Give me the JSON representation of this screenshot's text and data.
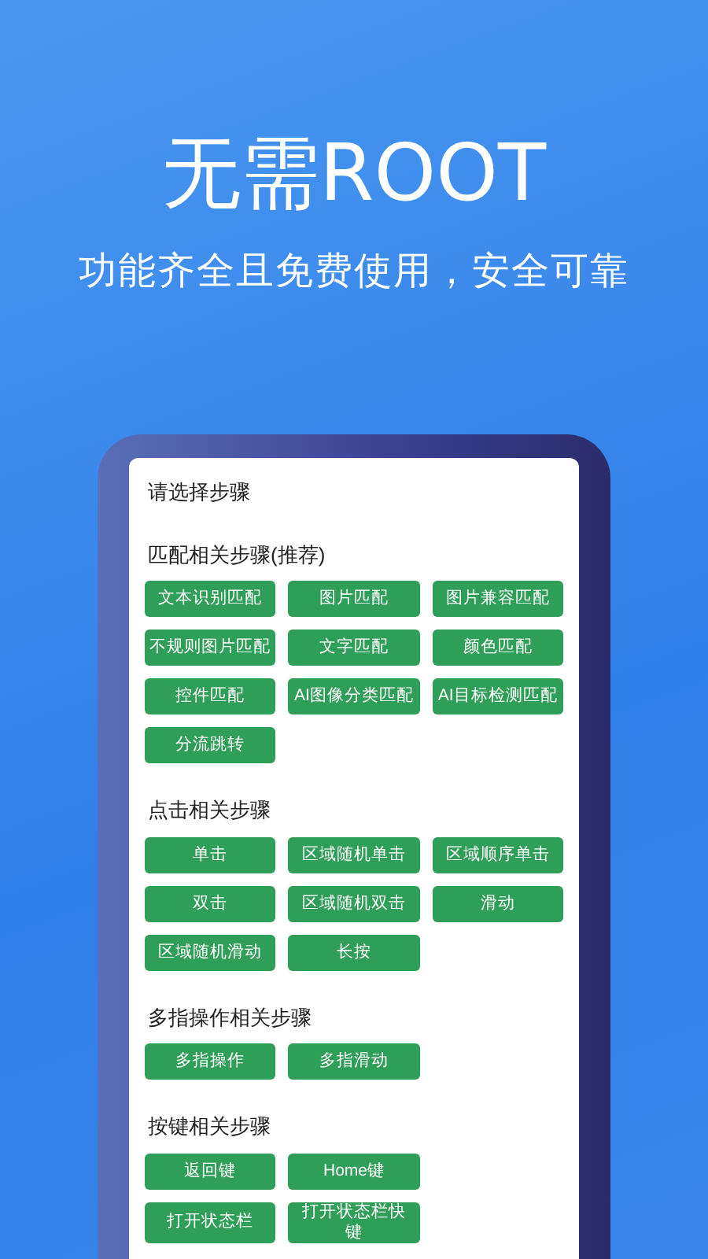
{
  "headline": "无需ROOT",
  "subtitle": "功能齐全且免费使用，安全可靠",
  "screen": {
    "title": "请选择步骤",
    "sections": [
      {
        "title": "匹配相关步骤(推荐)",
        "rows": [
          [
            {
              "lines": [
                "文本识别匹配"
              ]
            },
            {
              "lines": [
                "图片匹配"
              ]
            },
            {
              "lines": [
                "图片兼容匹配"
              ]
            }
          ],
          [
            {
              "lines": [
                "不规则图片匹配"
              ]
            },
            {
              "lines": [
                "文字匹配"
              ]
            },
            {
              "lines": [
                "颜色匹配"
              ]
            }
          ],
          [
            {
              "lines": [
                "控件匹配"
              ]
            },
            {
              "lines": [
                "AI图像分类匹配"
              ]
            },
            {
              "lines": [
                "AI目标检测匹配"
              ]
            }
          ],
          [
            {
              "lines": [
                "分流跳转"
              ]
            }
          ]
        ]
      },
      {
        "title": "点击相关步骤",
        "rows": [
          [
            {
              "lines": [
                "单击"
              ]
            },
            {
              "lines": [
                "区域随机单击"
              ]
            },
            {
              "lines": [
                "区域顺序单击"
              ]
            }
          ],
          [
            {
              "lines": [
                "双击"
              ]
            },
            {
              "lines": [
                "区域随机双击"
              ]
            },
            {
              "lines": [
                "滑动"
              ]
            }
          ],
          [
            {
              "lines": [
                "区域随机滑动"
              ]
            },
            {
              "lines": [
                "长按"
              ]
            }
          ]
        ]
      },
      {
        "title": "多指操作相关步骤",
        "rows": [
          [
            {
              "lines": [
                "多指操作"
              ]
            },
            {
              "lines": [
                "多指滑动"
              ]
            }
          ]
        ]
      },
      {
        "title": "按键相关步骤",
        "rows": [
          [
            {
              "lines": [
                "返回键"
              ]
            },
            {
              "lines": [
                "Home键"
              ]
            }
          ],
          [
            {
              "lines": [
                "打开状态栏"
              ]
            },
            {
              "lines": [
                "打开状态栏快",
                "键"
              ]
            }
          ]
        ]
      }
    ]
  }
}
